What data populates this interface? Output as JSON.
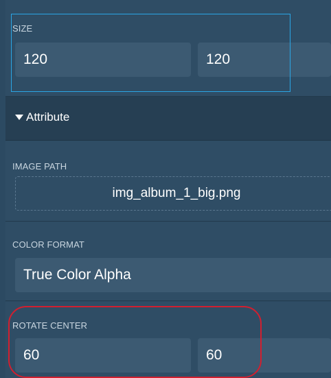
{
  "size": {
    "label": "SIZE",
    "width": "120",
    "height": "120"
  },
  "attribute_header": {
    "label": "Attribute",
    "icon": "caret-down-icon"
  },
  "image_path": {
    "label": "IMAGE PATH",
    "value": "img_album_1_big.png"
  },
  "color_format": {
    "label": "COLOR FORMAT",
    "value": "True Color Alpha"
  },
  "rotate_center": {
    "label": "ROTATE CENTER",
    "x": "60",
    "y": "60"
  },
  "colors": {
    "panel_bg": "#2e4c64",
    "field_bg": "#3c5a72",
    "header_bg": "#263f53",
    "focus_outline": "#2aa7e6",
    "highlight_ring": "#d21f2f"
  }
}
